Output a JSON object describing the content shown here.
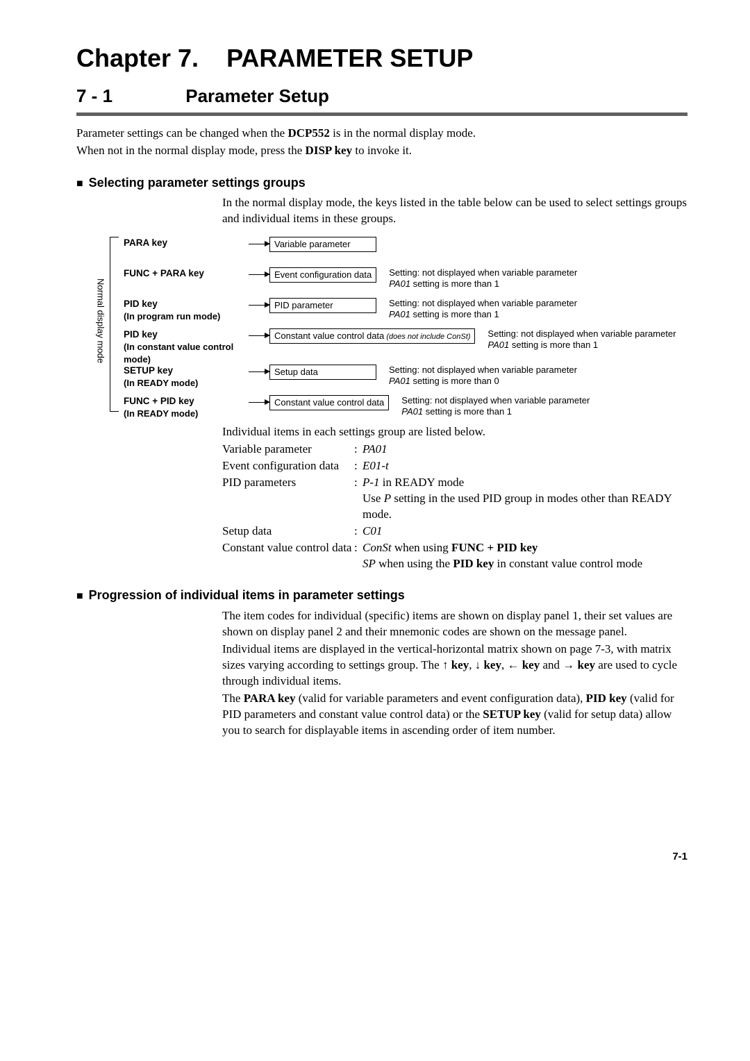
{
  "chapter": {
    "label": "Chapter 7.",
    "title": "PARAMETER SETUP"
  },
  "section": {
    "number": "7 - 1",
    "title": "Parameter Setup"
  },
  "intro": {
    "line1_pre": "Parameter settings can be changed when the ",
    "line1_bold": "DCP552",
    "line1_post": " is in  the normal display mode.",
    "line2_pre": "When not in the normal display mode, press the ",
    "line2_bold": "DISP key",
    "line2_post": " to invoke it."
  },
  "sub1": {
    "heading": "Selecting parameter settings groups",
    "para": "In the normal display mode, the keys listed in the table below can be used to select settings groups and individual items in these groups."
  },
  "diagram": {
    "mode_label": "Normal display mode",
    "rows": [
      {
        "key1": "PARA key",
        "key2": "",
        "box": "Variable parameter",
        "box_small": "",
        "note1": "",
        "note2_pre": "",
        "note2_i": "",
        "note2_post": ""
      },
      {
        "key1": "FUNC + PARA key",
        "key2": "",
        "box": "Event configuration data",
        "box_small": "",
        "note1": "Setting: not displayed when variable parameter",
        "note2_pre": "",
        "note2_i": "PA01",
        "note2_post": " setting is more than 1"
      },
      {
        "key1": "PID key",
        "key2": "(In program run mode)",
        "box": "PID parameter",
        "box_small": "",
        "note1": "Setting: not displayed when variable parameter",
        "note2_pre": "",
        "note2_i": "PA01",
        "note2_post": " setting is more than 1"
      },
      {
        "key1": "PID key",
        "key2": "(In constant value control mode)",
        "box": "Constant value control data",
        "box_small": " (does not include ConSt)",
        "note1": "Setting: not displayed when variable parameter",
        "note2_pre": "",
        "note2_i": "PA01",
        "note2_post": " setting is more than 1"
      },
      {
        "key1": "SETUP key",
        "key2": "(In READY mode)",
        "box": "Setup data",
        "box_small": "",
        "note1": "Setting: not displayed when variable parameter",
        "note2_pre": "",
        "note2_i": "PA01",
        "note2_post": " setting is more than 0"
      },
      {
        "key1": "FUNC + PID key",
        "key2": "(In READY mode)",
        "box": "Constant value control data",
        "box_small": "",
        "note1": "Setting: not displayed when variable parameter",
        "note2_pre": "",
        "note2_i": "PA01",
        "note2_post": " setting is more than 1"
      }
    ]
  },
  "items_intro": "Individual items in each settings group are listed below.",
  "items": {
    "r1_label": "Variable parameter",
    "r1_val_i": "PA01",
    "r2_label": "Event configuration data",
    "r2_val_i": "E01-t",
    "r3_label": "PID parameters",
    "r3_val_i": "P-1",
    "r3_val_post": " in READY mode",
    "r3b_pre": "Use ",
    "r3b_i": "P",
    "r3b_post": " setting in the used PID group in modes other than READY mode.",
    "r4_label": "Setup data",
    "r4_val_i": "C01",
    "r5_label": "Constant value control data",
    "r5_val_i": "ConSt",
    "r5_val_mid": " when using ",
    "r5_val_bold": "FUNC + PID key",
    "r5b_i": "SP",
    "r5b_mid": " when using the ",
    "r5b_bold": "PID key",
    "r5b_post": " in constant value control mode"
  },
  "sub2": {
    "heading": "Progression of individual items in parameter settings",
    "p1": "The item codes for individual (specific) items are shown on display panel 1, their set values are shown on display panel 2 and their mnemonic codes are shown on the message panel.",
    "p2_pre": "Individual items are displayed in the vertical-horizontal matrix shown on page 7-3, with matrix sizes varying according to settings group. The ",
    "p2_k1": "↑ key",
    "p2_s1": ", ",
    "p2_k2": "↓ key",
    "p2_s2": ", ",
    "p2_k3": "← key",
    "p2_mid": " and ",
    "p2_k4": "→ key",
    "p2_post": " are used to cycle through individual items.",
    "p3_pre": "The ",
    "p3_b1": "PARA key",
    "p3_m1": " (valid for variable parameters and event configuration data), ",
    "p3_b2": "PID key",
    "p3_m2": " (valid for PID parameters and constant value control data) or the ",
    "p3_b3": "SETUP key",
    "p3_post": " (valid for setup data) allow you to search for displayable items in ascending order of item number."
  },
  "page_number": "7-1"
}
